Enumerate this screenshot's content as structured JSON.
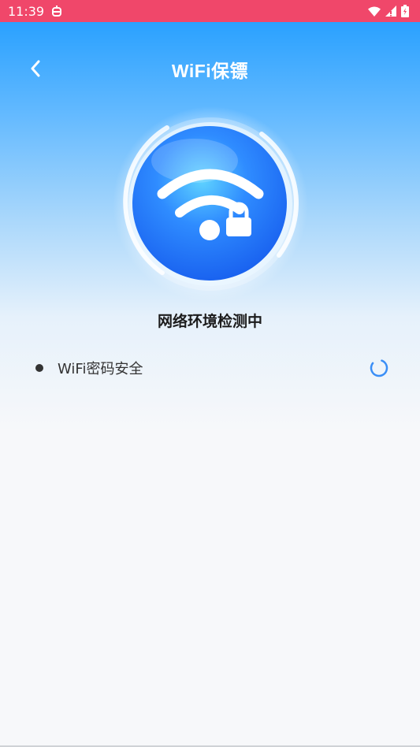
{
  "status_bar": {
    "time": "11:39",
    "icons": [
      "bug-icon",
      "wifi-icon",
      "signal-icon",
      "battery-icon"
    ]
  },
  "header": {
    "title": "WiFi保镖",
    "back_icon": "chevron-left-icon"
  },
  "hero": {
    "icon": "wifi-lock-icon",
    "status_text": "网络环境检测中"
  },
  "checks": [
    {
      "label": "WiFi密码安全",
      "state_icon": "loading-spinner-icon"
    }
  ],
  "colors": {
    "status_bar": "#f0476a",
    "gradient_top": "#2aa1ff",
    "accent": "#3a8ef6"
  }
}
